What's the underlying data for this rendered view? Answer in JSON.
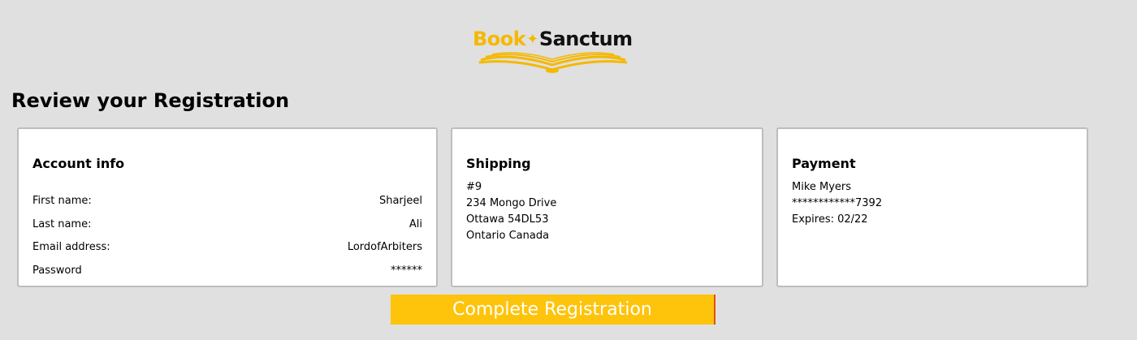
{
  "brand": {
    "name_part1": "Book",
    "name_part2": "Sanctum",
    "accent_color": "#f5b800"
  },
  "page_title": "Review your Registration",
  "account": {
    "title": "Account info",
    "rows": [
      {
        "label": "First name:",
        "value": "Sharjeel"
      },
      {
        "label": "Last name:",
        "value": "Ali"
      },
      {
        "label": "Email address:",
        "value": "LordofArbiters"
      },
      {
        "label": "Password",
        "value": "******"
      }
    ]
  },
  "shipping": {
    "title": "Shipping",
    "lines": [
      "#9",
      "234 Mongo Drive",
      "Ottawa 54DL53",
      "Ontario Canada"
    ]
  },
  "payment": {
    "title": "Payment",
    "lines": [
      "Mike Myers",
      "************7392",
      "Expires: 02/22"
    ]
  },
  "complete_button": {
    "label": "Complete Registration",
    "color": "#fec30b"
  }
}
